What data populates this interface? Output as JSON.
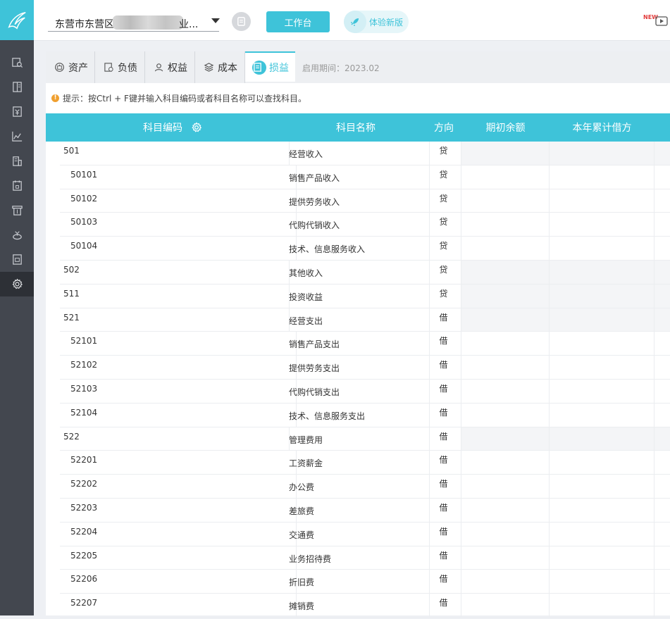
{
  "topbar": {
    "company_prefix": "东营市东营区",
    "company_suffix": "业...",
    "workbench": "工作台",
    "new_version": "体验新版",
    "video_badge": "NEW"
  },
  "tabs": [
    {
      "label": "资产",
      "icon": "asset-icon"
    },
    {
      "label": "负债",
      "icon": "liability-icon"
    },
    {
      "label": "权益",
      "icon": "equity-icon"
    },
    {
      "label": "成本",
      "icon": "cost-icon"
    },
    {
      "label": "损益",
      "icon": "profit-loss-icon",
      "active": true
    }
  ],
  "enable_date": "启用期间：2023.02",
  "tip": "提示：按Ctrl + F键并输入科目编码或者科目名称可以查找科目。",
  "columns": {
    "code": "科目编码",
    "name": "科目名称",
    "direction": "方向",
    "opening": "期初余额",
    "ytd_debit": "本年累计借方"
  },
  "rows": [
    {
      "code": "501",
      "name": "经营收入",
      "dir": "贷",
      "level": 1
    },
    {
      "code": "50101",
      "name": "销售产品收入",
      "dir": "贷",
      "level": 2
    },
    {
      "code": "50102",
      "name": "提供劳务收入",
      "dir": "贷",
      "level": 2
    },
    {
      "code": "50103",
      "name": "代购代销收入",
      "dir": "贷",
      "level": 2
    },
    {
      "code": "50104",
      "name": "技术、信息服务收入",
      "dir": "贷",
      "level": 2
    },
    {
      "code": "502",
      "name": "其他收入",
      "dir": "贷",
      "level": 1
    },
    {
      "code": "511",
      "name": "投资收益",
      "dir": "贷",
      "level": 1
    },
    {
      "code": "521",
      "name": "经营支出",
      "dir": "借",
      "level": 1
    },
    {
      "code": "52101",
      "name": "销售产品支出",
      "dir": "借",
      "level": 2
    },
    {
      "code": "52102",
      "name": "提供劳务支出",
      "dir": "借",
      "level": 2
    },
    {
      "code": "52103",
      "name": "代购代销支出",
      "dir": "借",
      "level": 2
    },
    {
      "code": "52104",
      "name": "技术、信息服务支出",
      "dir": "借",
      "level": 2
    },
    {
      "code": "522",
      "name": "管理费用",
      "dir": "借",
      "level": 1
    },
    {
      "code": "52201",
      "name": "工资薪金",
      "dir": "借",
      "level": 2
    },
    {
      "code": "52202",
      "name": "办公费",
      "dir": "借",
      "level": 2
    },
    {
      "code": "52203",
      "name": "差旅费",
      "dir": "借",
      "level": 2
    },
    {
      "code": "52204",
      "name": "交通费",
      "dir": "借",
      "level": 2
    },
    {
      "code": "52205",
      "name": "业务招待费",
      "dir": "借",
      "level": 2
    },
    {
      "code": "52206",
      "name": "折旧费",
      "dir": "借",
      "level": 2
    },
    {
      "code": "52207",
      "name": "摊销费",
      "dir": "借",
      "level": 2
    }
  ],
  "colors": {
    "accent": "#3ec3d9",
    "sidebar": "#43474f"
  }
}
